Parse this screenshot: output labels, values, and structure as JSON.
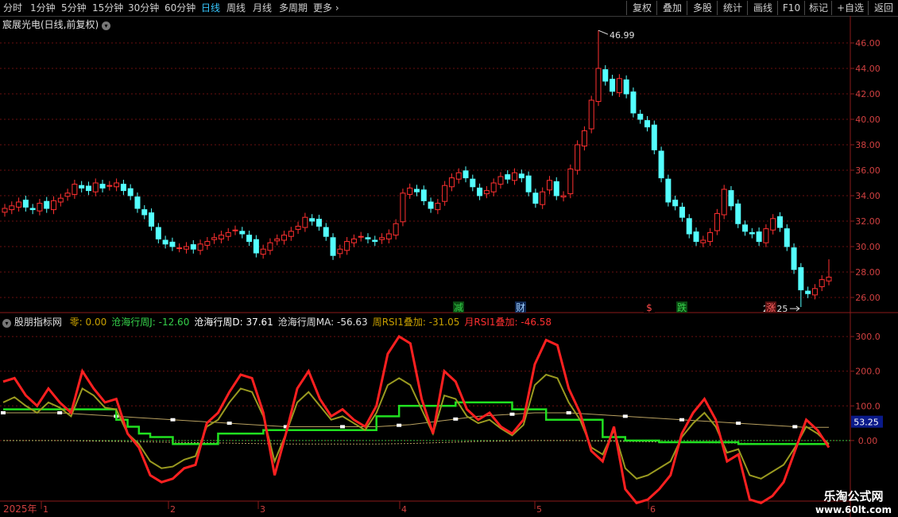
{
  "toolbar": {
    "timeframes": [
      "分时",
      "1分钟",
      "5分钟",
      "15分钟",
      "30分钟",
      "60分钟",
      "日线",
      "周线",
      "月线",
      "多周期",
      "更多"
    ],
    "active_timeframe": "日线",
    "right_buttons": [
      "复权",
      "叠加",
      "多股",
      "统计",
      "画线",
      "F10",
      "标记",
      "+自选",
      "返回"
    ]
  },
  "stock": {
    "title": "宸展光电(日线,前复权)",
    "high_label": "46.99",
    "low_label": "25.25"
  },
  "price_axis": [
    "46.00",
    "44.00",
    "42.00",
    "40.00",
    "38.00",
    "36.00",
    "34.00",
    "32.00",
    "30.00",
    "28.00",
    "26.00"
  ],
  "event_markers": [
    {
      "text": "减",
      "color": "#35d04a",
      "bg": "#0b4a12"
    },
    {
      "text": "财",
      "color": "#9fd0ff",
      "bg": "#112a55"
    },
    {
      "text": "$",
      "color": "#ff4a4a",
      "bg": "#000000"
    },
    {
      "text": "跌",
      "color": "#35d04a",
      "bg": "#0b4a12"
    },
    {
      "text": "涨",
      "color": "#ff6060",
      "bg": "#551111"
    }
  ],
  "indicator": {
    "name": "股朋指标网",
    "items": [
      {
        "label": "零: 0.00",
        "color": "#c8a000"
      },
      {
        "label": "沧海行周J: -12.60",
        "color": "#35d04a"
      },
      {
        "label": "沧海行周D: 37.61",
        "color": "#ffffff"
      },
      {
        "label": "沧海行周MA: -56.63",
        "color": "#e0e0e0"
      },
      {
        "label": "周RSI1叠加: -31.05",
        "color": "#c8a000"
      },
      {
        "label": "月RSI1叠加: -46.58",
        "color": "#ff3030"
      }
    ],
    "axis": [
      "300.0",
      "200.0",
      "100.0",
      "0.00"
    ],
    "current_value": "53.25"
  },
  "date_axis": {
    "year": "2025年",
    "months": [
      "1",
      "2",
      "3",
      "4",
      "5",
      "6"
    ]
  },
  "watermark": {
    "line1": "乐淘公式网",
    "line2": "www.60lt.com"
  },
  "colors": {
    "up": "#ff3030",
    "down": "#54ffff",
    "grid": "#6a1010",
    "axis": "#8a1a1a"
  },
  "chart_data": [
    {
      "type": "candlestick",
      "title": "宸展光电(日线,前复权)",
      "ylim": [
        25.0,
        47.0
      ],
      "high": 46.99,
      "low": 25.25,
      "close_series": [
        33.0,
        33.2,
        33.5,
        33.1,
        32.9,
        33.4,
        33.0,
        33.6,
        33.8,
        34.2,
        34.9,
        34.6,
        34.4,
        35.0,
        34.6,
        34.8,
        35.0,
        34.4,
        34.0,
        33.0,
        32.5,
        31.6,
        30.6,
        30.2,
        30.0,
        29.9,
        30.0,
        29.8,
        30.2,
        30.4,
        30.7,
        30.9,
        31.1,
        31.3,
        31.0,
        30.4,
        29.5,
        29.8,
        30.3,
        30.6,
        30.9,
        31.2,
        31.6,
        32.3,
        32.0,
        31.6,
        30.8,
        29.3,
        29.8,
        30.4,
        30.6,
        30.8,
        30.6,
        30.4,
        30.7,
        31.0,
        31.8,
        34.2,
        34.6,
        34.3,
        33.6,
        33.0,
        33.4,
        34.8,
        35.4,
        35.8,
        35.4,
        34.7,
        34.0,
        34.4,
        35.0,
        35.5,
        35.3,
        35.8,
        35.4,
        34.3,
        33.4,
        34.3,
        35.2,
        34.0,
        34.0,
        36.1,
        38.0,
        39.1,
        41.5,
        44.0,
        43.0,
        42.2,
        43.2,
        42.0,
        40.5,
        40.0,
        39.4,
        37.6,
        35.4,
        33.5,
        33.2,
        32.3,
        31.0,
        30.4,
        30.5,
        31.1,
        32.6,
        34.5,
        33.2,
        31.8,
        31.2,
        31.0,
        30.4,
        31.4,
        32.2,
        31.5,
        30.0,
        28.2,
        26.6,
        26.3,
        26.7,
        27.4,
        27.6
      ],
      "xlabel": "",
      "ylabel": ""
    },
    {
      "type": "line",
      "title": "股朋指标网",
      "ylim": [
        -170,
        330
      ],
      "series": [
        {
          "name": "月RSI1叠加",
          "values": [
            170,
            180,
            130,
            100,
            150,
            110,
            80,
            200,
            150,
            110,
            120,
            20,
            -20,
            -100,
            -120,
            -110,
            -80,
            -70,
            50,
            80,
            140,
            190,
            180,
            80,
            -100,
            20,
            150,
            200,
            120,
            70,
            90,
            60,
            40,
            100,
            250,
            300,
            280,
            120,
            20,
            200,
            170,
            90,
            60,
            80,
            40,
            20,
            60,
            220,
            290,
            275,
            150,
            80,
            -30,
            -60,
            40,
            -140,
            -180,
            -170,
            -140,
            -100,
            20,
            80,
            120,
            60,
            -60,
            -40,
            -170,
            -180,
            -160,
            -120,
            -30,
            60,
            30,
            -20
          ]
        },
        {
          "name": "周RSI1叠加",
          "values": [
            110,
            125,
            100,
            80,
            110,
            95,
            70,
            150,
            130,
            95,
            90,
            20,
            -10,
            -60,
            -80,
            -75,
            -55,
            -45,
            40,
            60,
            110,
            150,
            140,
            70,
            -60,
            20,
            110,
            140,
            100,
            60,
            70,
            50,
            30,
            80,
            160,
            180,
            160,
            90,
            20,
            130,
            120,
            70,
            50,
            60,
            35,
            15,
            45,
            160,
            190,
            180,
            110,
            60,
            -20,
            -40,
            30,
            -80,
            -110,
            -100,
            -80,
            -60,
            10,
            50,
            80,
            40,
            -35,
            -25,
            -100,
            -110,
            -90,
            -70,
            -20,
            40,
            20,
            -10
          ]
        },
        {
          "name": "沧海行周J",
          "values": [
            90,
            90,
            90,
            90,
            90,
            90,
            90,
            90,
            90,
            90,
            60,
            40,
            20,
            10,
            10,
            -10,
            -10,
            -10,
            -10,
            20,
            20,
            20,
            20,
            30,
            30,
            30,
            30,
            30,
            30,
            30,
            30,
            30,
            30,
            70,
            70,
            100,
            100,
            100,
            100,
            100,
            110,
            110,
            110,
            110,
            110,
            90,
            90,
            90,
            60,
            60,
            60,
            60,
            60,
            10,
            10,
            0,
            0,
            0,
            -5,
            -5,
            -5,
            -5,
            -5,
            -5,
            -5,
            -10,
            -10,
            -10,
            -10,
            -10,
            -10,
            -10,
            -10,
            -10
          ]
        },
        {
          "name": "沧海行周D",
          "values": [
            80,
            80,
            80,
            80,
            80,
            80,
            78,
            76,
            74,
            72,
            70,
            68,
            66,
            64,
            62,
            60,
            58,
            56,
            54,
            52,
            50,
            48,
            46,
            44,
            42,
            40,
            40,
            40,
            40,
            40,
            40,
            40,
            40,
            40,
            42,
            44,
            46,
            50,
            54,
            58,
            62,
            66,
            70,
            72,
            74,
            76,
            78,
            80,
            80,
            80,
            80,
            78,
            76,
            74,
            72,
            70,
            68,
            66,
            64,
            62,
            60,
            58,
            56,
            54,
            52,
            50,
            48,
            46,
            44,
            42,
            40,
            38,
            38,
            38
          ]
        }
      ],
      "xlabel": "",
      "ylabel": ""
    }
  ]
}
